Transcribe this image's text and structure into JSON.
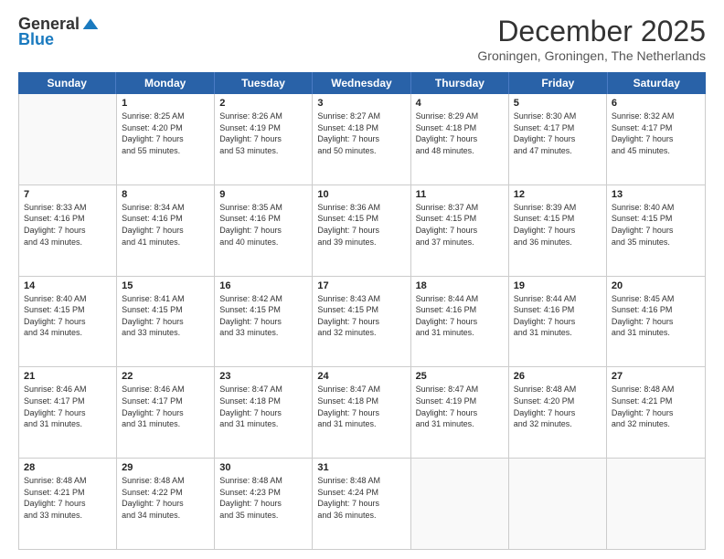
{
  "logo": {
    "general": "General",
    "blue": "Blue"
  },
  "header": {
    "month": "December 2025",
    "location": "Groningen, Groningen, The Netherlands"
  },
  "days": [
    "Sunday",
    "Monday",
    "Tuesday",
    "Wednesday",
    "Thursday",
    "Friday",
    "Saturday"
  ],
  "weeks": [
    [
      {
        "day": "",
        "info": ""
      },
      {
        "day": "1",
        "info": "Sunrise: 8:25 AM\nSunset: 4:20 PM\nDaylight: 7 hours\nand 55 minutes."
      },
      {
        "day": "2",
        "info": "Sunrise: 8:26 AM\nSunset: 4:19 PM\nDaylight: 7 hours\nand 53 minutes."
      },
      {
        "day": "3",
        "info": "Sunrise: 8:27 AM\nSunset: 4:18 PM\nDaylight: 7 hours\nand 50 minutes."
      },
      {
        "day": "4",
        "info": "Sunrise: 8:29 AM\nSunset: 4:18 PM\nDaylight: 7 hours\nand 48 minutes."
      },
      {
        "day": "5",
        "info": "Sunrise: 8:30 AM\nSunset: 4:17 PM\nDaylight: 7 hours\nand 47 minutes."
      },
      {
        "day": "6",
        "info": "Sunrise: 8:32 AM\nSunset: 4:17 PM\nDaylight: 7 hours\nand 45 minutes."
      }
    ],
    [
      {
        "day": "7",
        "info": "Sunrise: 8:33 AM\nSunset: 4:16 PM\nDaylight: 7 hours\nand 43 minutes."
      },
      {
        "day": "8",
        "info": "Sunrise: 8:34 AM\nSunset: 4:16 PM\nDaylight: 7 hours\nand 41 minutes."
      },
      {
        "day": "9",
        "info": "Sunrise: 8:35 AM\nSunset: 4:16 PM\nDaylight: 7 hours\nand 40 minutes."
      },
      {
        "day": "10",
        "info": "Sunrise: 8:36 AM\nSunset: 4:15 PM\nDaylight: 7 hours\nand 39 minutes."
      },
      {
        "day": "11",
        "info": "Sunrise: 8:37 AM\nSunset: 4:15 PM\nDaylight: 7 hours\nand 37 minutes."
      },
      {
        "day": "12",
        "info": "Sunrise: 8:39 AM\nSunset: 4:15 PM\nDaylight: 7 hours\nand 36 minutes."
      },
      {
        "day": "13",
        "info": "Sunrise: 8:40 AM\nSunset: 4:15 PM\nDaylight: 7 hours\nand 35 minutes."
      }
    ],
    [
      {
        "day": "14",
        "info": "Sunrise: 8:40 AM\nSunset: 4:15 PM\nDaylight: 7 hours\nand 34 minutes."
      },
      {
        "day": "15",
        "info": "Sunrise: 8:41 AM\nSunset: 4:15 PM\nDaylight: 7 hours\nand 33 minutes."
      },
      {
        "day": "16",
        "info": "Sunrise: 8:42 AM\nSunset: 4:15 PM\nDaylight: 7 hours\nand 33 minutes."
      },
      {
        "day": "17",
        "info": "Sunrise: 8:43 AM\nSunset: 4:15 PM\nDaylight: 7 hours\nand 32 minutes."
      },
      {
        "day": "18",
        "info": "Sunrise: 8:44 AM\nSunset: 4:16 PM\nDaylight: 7 hours\nand 31 minutes."
      },
      {
        "day": "19",
        "info": "Sunrise: 8:44 AM\nSunset: 4:16 PM\nDaylight: 7 hours\nand 31 minutes."
      },
      {
        "day": "20",
        "info": "Sunrise: 8:45 AM\nSunset: 4:16 PM\nDaylight: 7 hours\nand 31 minutes."
      }
    ],
    [
      {
        "day": "21",
        "info": "Sunrise: 8:46 AM\nSunset: 4:17 PM\nDaylight: 7 hours\nand 31 minutes."
      },
      {
        "day": "22",
        "info": "Sunrise: 8:46 AM\nSunset: 4:17 PM\nDaylight: 7 hours\nand 31 minutes."
      },
      {
        "day": "23",
        "info": "Sunrise: 8:47 AM\nSunset: 4:18 PM\nDaylight: 7 hours\nand 31 minutes."
      },
      {
        "day": "24",
        "info": "Sunrise: 8:47 AM\nSunset: 4:18 PM\nDaylight: 7 hours\nand 31 minutes."
      },
      {
        "day": "25",
        "info": "Sunrise: 8:47 AM\nSunset: 4:19 PM\nDaylight: 7 hours\nand 31 minutes."
      },
      {
        "day": "26",
        "info": "Sunrise: 8:48 AM\nSunset: 4:20 PM\nDaylight: 7 hours\nand 32 minutes."
      },
      {
        "day": "27",
        "info": "Sunrise: 8:48 AM\nSunset: 4:21 PM\nDaylight: 7 hours\nand 32 minutes."
      }
    ],
    [
      {
        "day": "28",
        "info": "Sunrise: 8:48 AM\nSunset: 4:21 PM\nDaylight: 7 hours\nand 33 minutes."
      },
      {
        "day": "29",
        "info": "Sunrise: 8:48 AM\nSunset: 4:22 PM\nDaylight: 7 hours\nand 34 minutes."
      },
      {
        "day": "30",
        "info": "Sunrise: 8:48 AM\nSunset: 4:23 PM\nDaylight: 7 hours\nand 35 minutes."
      },
      {
        "day": "31",
        "info": "Sunrise: 8:48 AM\nSunset: 4:24 PM\nDaylight: 7 hours\nand 36 minutes."
      },
      {
        "day": "",
        "info": ""
      },
      {
        "day": "",
        "info": ""
      },
      {
        "day": "",
        "info": ""
      }
    ]
  ]
}
